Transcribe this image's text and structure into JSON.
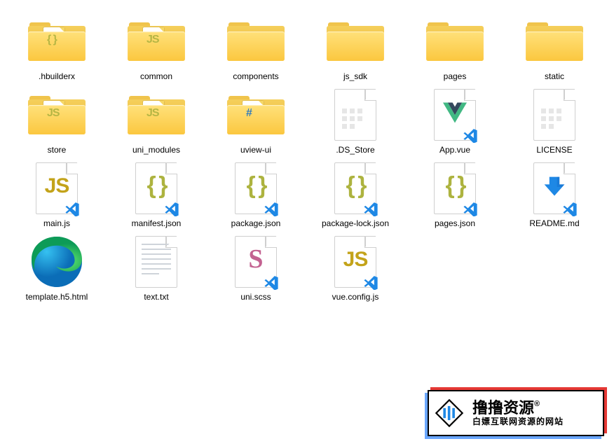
{
  "items": [
    {
      "name": ".hbuilderx",
      "kind": "folder",
      "badge": "{ }"
    },
    {
      "name": "common",
      "kind": "folder",
      "badge": "JS"
    },
    {
      "name": "components",
      "kind": "folder-plain"
    },
    {
      "name": "js_sdk",
      "kind": "folder-plain"
    },
    {
      "name": "pages",
      "kind": "folder-plain"
    },
    {
      "name": "static",
      "kind": "folder-plain"
    },
    {
      "name": "store",
      "kind": "folder",
      "badge": "JS"
    },
    {
      "name": "uni_modules",
      "kind": "folder",
      "badge": "JS"
    },
    {
      "name": "uview-ui",
      "kind": "folder",
      "badge": "#",
      "badgeClass": "hash"
    },
    {
      "name": ".DS_Store",
      "kind": "blank-file"
    },
    {
      "name": "App.vue",
      "kind": "vue-file"
    },
    {
      "name": "LICENSE",
      "kind": "blank-file"
    },
    {
      "name": "main.js",
      "kind": "js-file"
    },
    {
      "name": "manifest.json",
      "kind": "json-file"
    },
    {
      "name": "package.json",
      "kind": "json-file"
    },
    {
      "name": "package-lock.json",
      "kind": "json-file"
    },
    {
      "name": "pages.json",
      "kind": "json-file"
    },
    {
      "name": "README.md",
      "kind": "md-file"
    },
    {
      "name": "template.h5.html",
      "kind": "html-file"
    },
    {
      "name": "text.txt",
      "kind": "txt-file"
    },
    {
      "name": "uni.scss",
      "kind": "scss-file"
    },
    {
      "name": "vue.config.js",
      "kind": "js-file"
    }
  ],
  "watermark": {
    "title": "撸撸资源",
    "reg": "®",
    "subtitle": "白嫖互联网资源的网站"
  }
}
